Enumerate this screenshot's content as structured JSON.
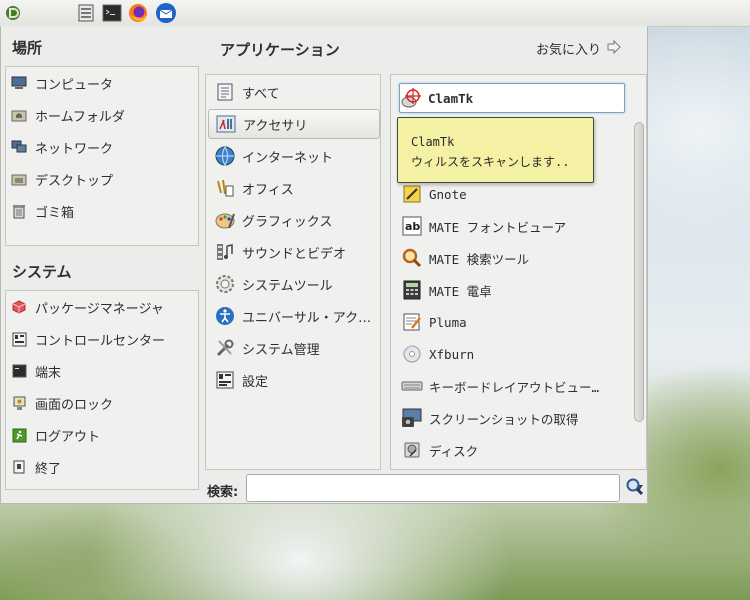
{
  "panel": {
    "icons": [
      "menu-logo-icon",
      "files-icon",
      "terminal-icon",
      "firefox-icon",
      "thunderbird-icon"
    ]
  },
  "places": {
    "title": "場所",
    "items": [
      {
        "label": "コンピュータ",
        "icon": "computer-icon"
      },
      {
        "label": "ホームフォルダ",
        "icon": "home-folder-icon"
      },
      {
        "label": "ネットワーク",
        "icon": "network-icon"
      },
      {
        "label": "デスクトップ",
        "icon": "desktop-icon"
      },
      {
        "label": "ゴミ箱",
        "icon": "trash-icon"
      }
    ]
  },
  "system": {
    "title": "システム",
    "items": [
      {
        "label": "パッケージマネージャ",
        "icon": "package-icon"
      },
      {
        "label": "コントロールセンター",
        "icon": "control-center-icon"
      },
      {
        "label": "端末",
        "icon": "terminal-icon"
      },
      {
        "label": "画面のロック",
        "icon": "lock-screen-icon"
      },
      {
        "label": "ログアウト",
        "icon": "logout-icon"
      },
      {
        "label": "終了",
        "icon": "shutdown-icon"
      }
    ]
  },
  "applications": {
    "title": "アプリケーション",
    "favorites_label": "お気に入り",
    "categories": [
      {
        "label": "すべて",
        "icon": "all-apps-icon"
      },
      {
        "label": "アクセサリ",
        "icon": "accessories-icon",
        "selected": true
      },
      {
        "label": "インターネット",
        "icon": "internet-icon"
      },
      {
        "label": "オフィス",
        "icon": "office-icon"
      },
      {
        "label": "グラフィックス",
        "icon": "graphics-icon"
      },
      {
        "label": "サウンドとビデオ",
        "icon": "sound-video-icon"
      },
      {
        "label": "システムツール",
        "icon": "system-tools-icon"
      },
      {
        "label": "ユニバーサル・アク…",
        "icon": "universal-access-icon"
      },
      {
        "label": "システム管理",
        "icon": "administration-icon"
      },
      {
        "label": "設定",
        "icon": "settings-icon"
      }
    ],
    "apps": [
      {
        "label": "ClamTk",
        "icon": "clamtk-icon",
        "selected": true
      },
      {
        "label": "",
        "icon": ""
      },
      {
        "label": "",
        "icon": ""
      },
      {
        "label": "Gnote",
        "icon": "gnote-icon"
      },
      {
        "label": "MATE フォントビューア",
        "icon": "font-viewer-icon"
      },
      {
        "label": "MATE 検索ツール",
        "icon": "search-tool-icon"
      },
      {
        "label": "MATE 電卓",
        "icon": "calculator-icon"
      },
      {
        "label": "Pluma",
        "icon": "pluma-icon"
      },
      {
        "label": "Xfburn",
        "icon": "xfburn-icon"
      },
      {
        "label": "キーボードレイアウトビュー…",
        "icon": "keyboard-icon"
      },
      {
        "label": "スクリーンショットの取得",
        "icon": "screenshot-icon"
      },
      {
        "label": "ディスク",
        "icon": "disks-icon"
      }
    ]
  },
  "tooltip": {
    "title": "ClamTk",
    "text": "ウィルスをスキャンします.."
  },
  "search": {
    "label": "検索:",
    "value": "",
    "placeholder": ""
  }
}
